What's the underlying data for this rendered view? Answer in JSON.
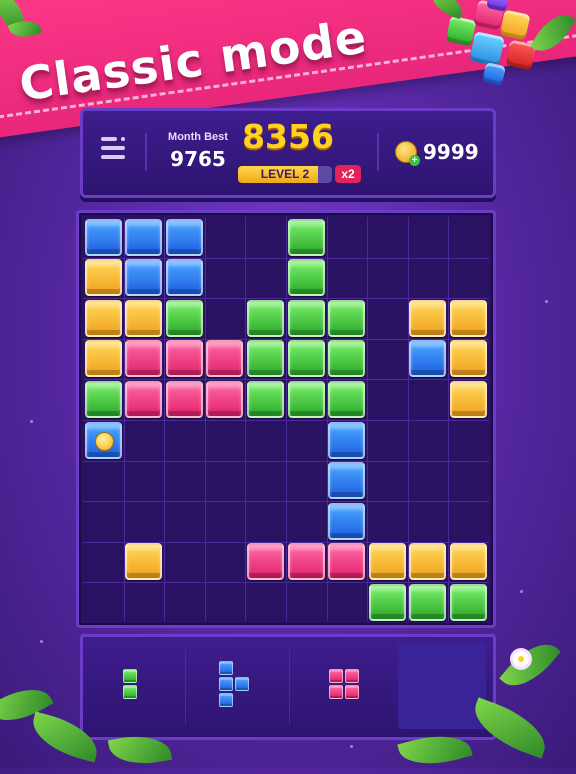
{
  "banner": {
    "title": "Classic mode"
  },
  "header": {
    "month_best_label": "Month Best",
    "month_best_value": "9765",
    "score": "8356",
    "level_label": "LEVEL 2",
    "level_progress_percent": 85,
    "multiplier": "x2",
    "coins": "9999",
    "menu_icon": "menu-icon",
    "coin_icon": "coin-plus-icon"
  },
  "board": {
    "rows": 10,
    "cols": 10,
    "cells": [
      [
        "B",
        "B",
        "B",
        ".",
        ".",
        "G",
        ".",
        ".",
        ".",
        "."
      ],
      [
        "Y",
        "B",
        "B",
        ".",
        ".",
        "G",
        ".",
        ".",
        ".",
        "."
      ],
      [
        "Y",
        "Y",
        "G",
        ".",
        "G",
        "G",
        "G",
        ".",
        "Y",
        "Y"
      ],
      [
        "Y",
        "P",
        "P",
        "P",
        "G",
        "G",
        "G",
        ".",
        "B",
        "Y"
      ],
      [
        "G",
        "P",
        "P",
        "P",
        "G",
        "G",
        "G",
        ".",
        ".",
        "Y"
      ],
      [
        "C",
        ".",
        ".",
        ".",
        ".",
        ".",
        "B",
        ".",
        ".",
        "."
      ],
      [
        ".",
        ".",
        ".",
        ".",
        ".",
        ".",
        "B",
        ".",
        ".",
        "."
      ],
      [
        ".",
        ".",
        ".",
        ".",
        ".",
        ".",
        "B",
        ".",
        ".",
        "."
      ],
      [
        ".",
        "Y",
        ".",
        ".",
        "P",
        "P",
        "P",
        "Y",
        "Y",
        "Y"
      ],
      [
        ".",
        ".",
        ".",
        ".",
        ".",
        ".",
        ".",
        "G",
        "G",
        "G"
      ]
    ],
    "colors": {
      "B": "#2f7ef0",
      "G": "#4cc83c",
      "Y": "#f8c23a",
      "P": "#f23f86"
    }
  },
  "tray": {
    "pieces": [
      {
        "name": "green-vertical-piece",
        "color": "G",
        "cells": [
          [
            0,
            0
          ],
          [
            1,
            0
          ]
        ]
      },
      {
        "name": "blue-t-piece",
        "color": "B",
        "cells": [
          [
            0,
            0
          ],
          [
            1,
            0
          ],
          [
            1,
            1
          ],
          [
            2,
            0
          ]
        ]
      },
      {
        "name": "pink-square-piece",
        "color": "P",
        "cells": [
          [
            0,
            0
          ],
          [
            0,
            1
          ],
          [
            1,
            0
          ],
          [
            1,
            1
          ]
        ]
      }
    ]
  }
}
